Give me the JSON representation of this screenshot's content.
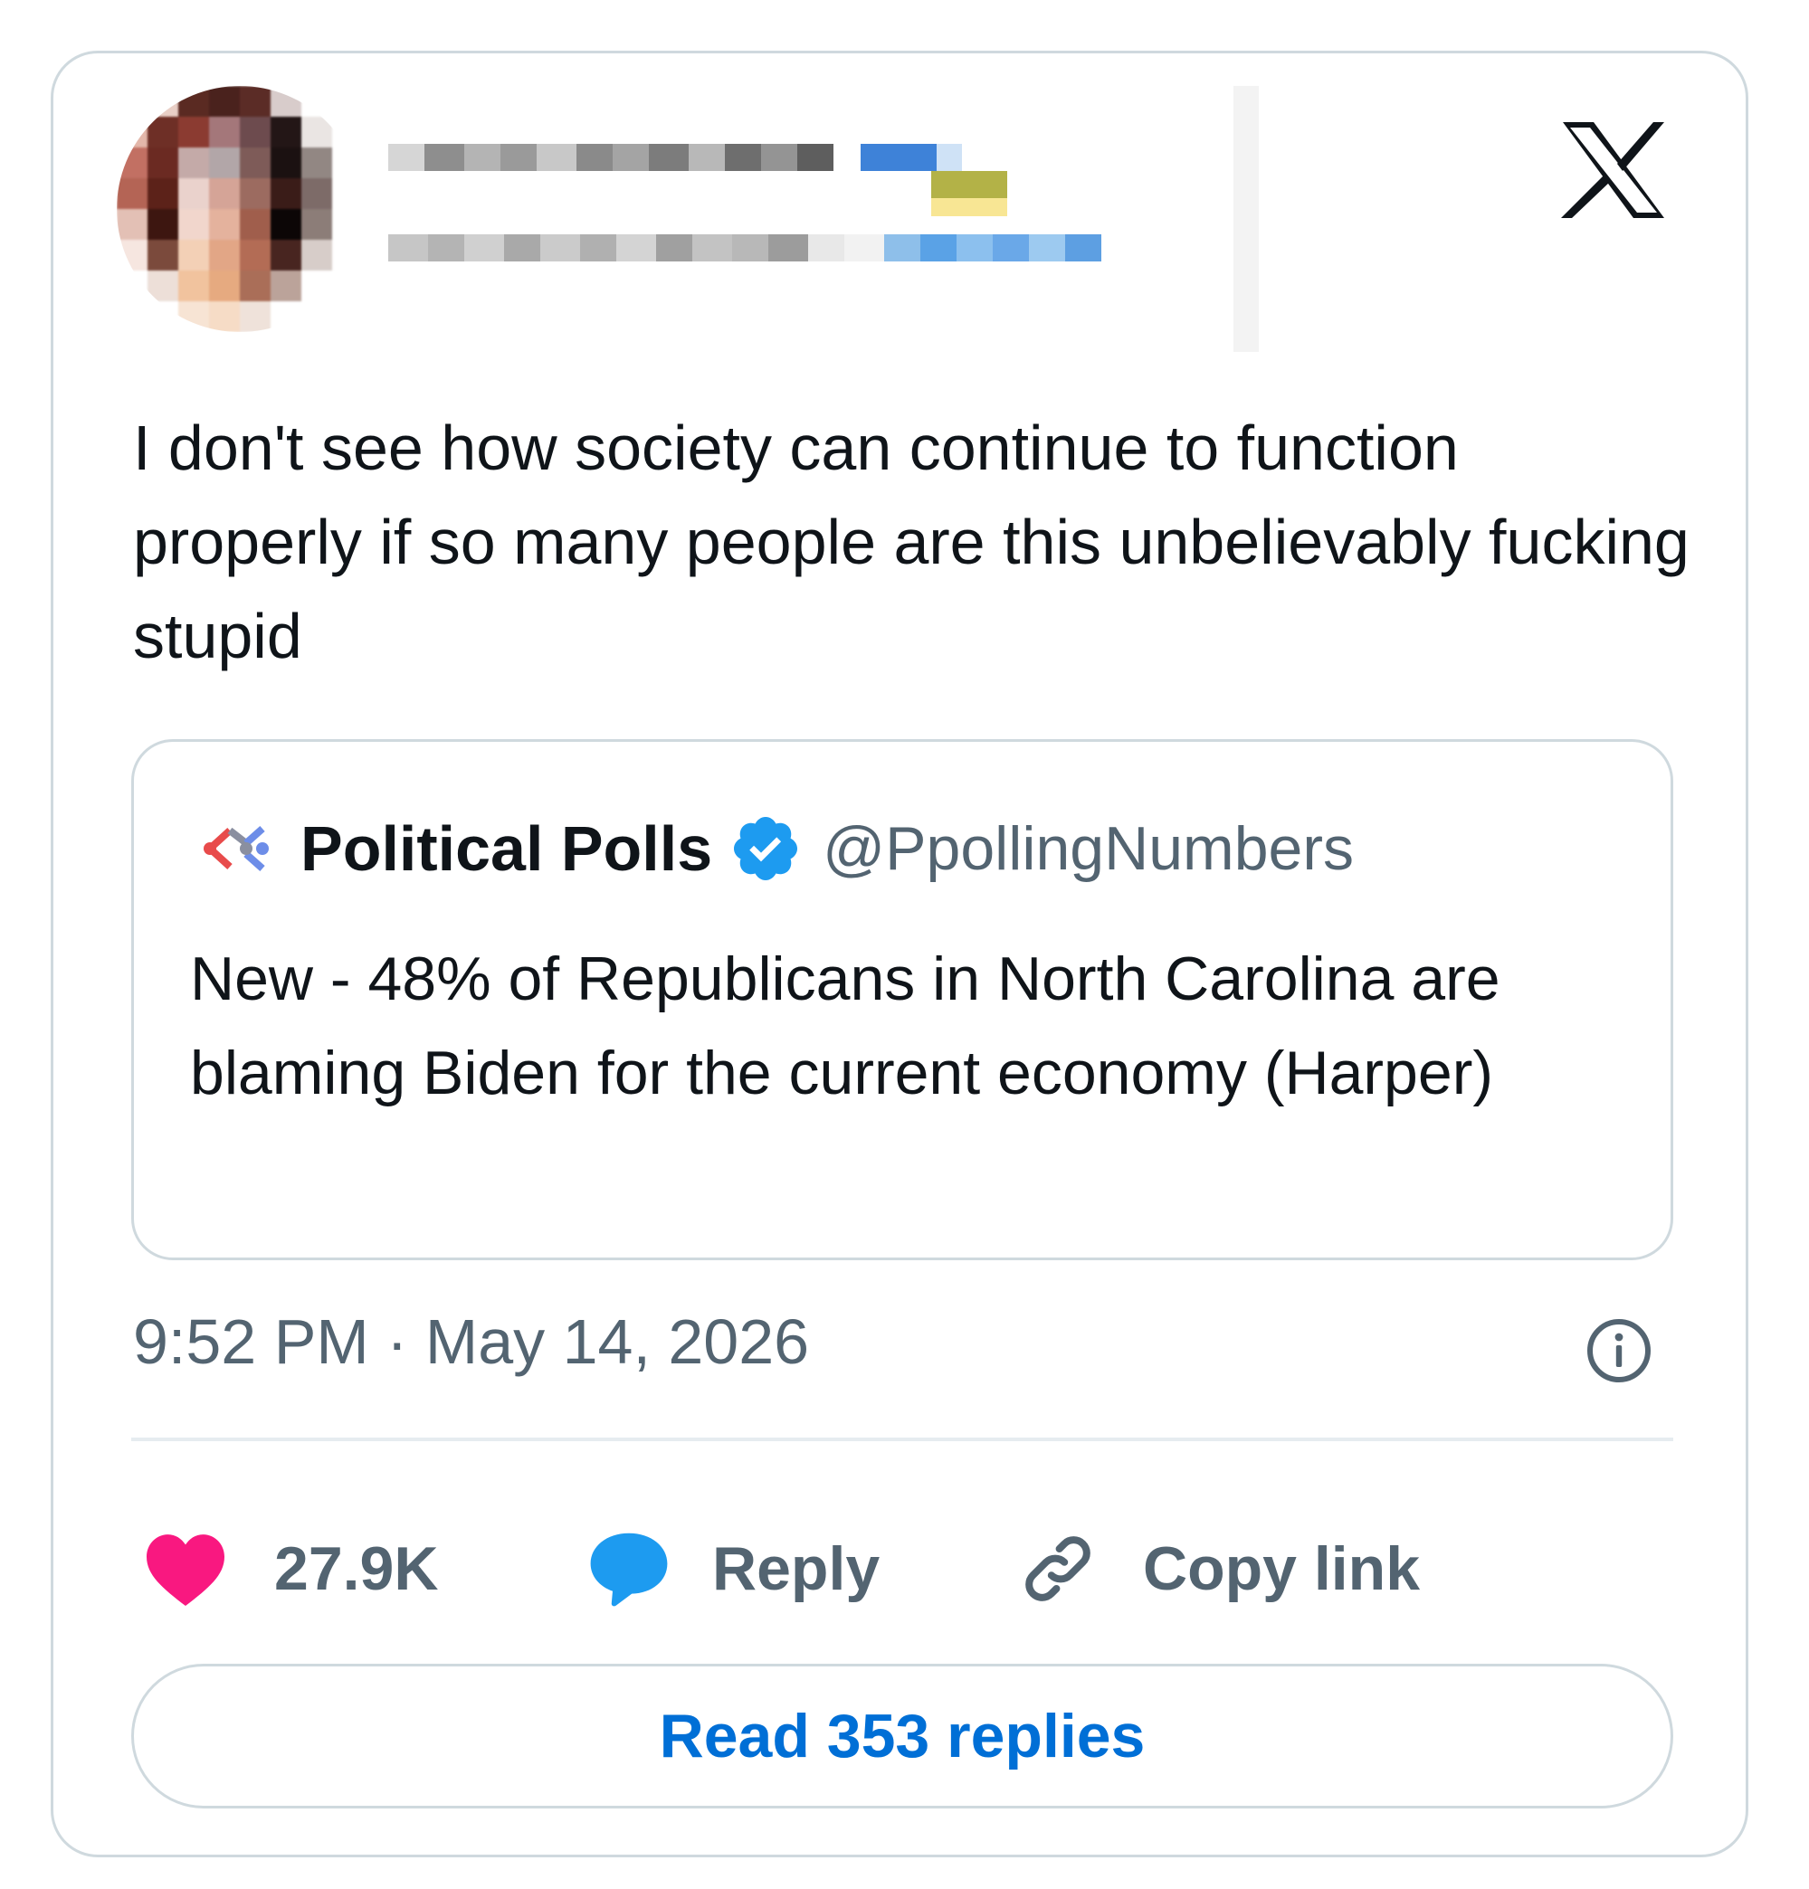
{
  "author": {
    "avatar_icon": "blurred-avatar",
    "name_text": "",
    "handle_text": ""
  },
  "platform_logo": "x-logo",
  "tweet": {
    "text": "I don't see how society can continue to function properly if so many people are this unbelievably fucking stupid"
  },
  "quote": {
    "author_name": "Political Polls",
    "handle": "@PpollingNumbers",
    "verified": true,
    "text": "New - 48% of Republicans in North Carolina are blaming Biden for the current economy (Harper)"
  },
  "timestamp": "9:52 PM · May 14, 2026",
  "actions": {
    "likes": "27.9K",
    "reply_label": "Reply",
    "copy_link_label": "Copy link"
  },
  "read_replies_label": "Read 353 replies",
  "colors": {
    "like": "#f91880",
    "reply": "#1d9bf0",
    "link_text": "#006fd6",
    "muted": "#536471",
    "border": "#cfd9de",
    "verified": "#1d9bf0"
  }
}
